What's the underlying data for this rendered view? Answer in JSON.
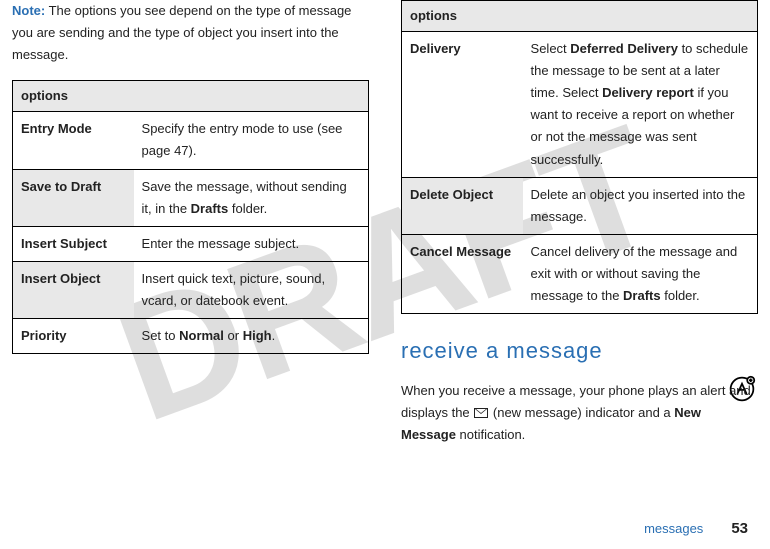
{
  "watermark": "DRAFT",
  "left": {
    "note_label": "Note:",
    "note_text": " The options you see depend on the type of message you are sending and the type of object you insert into the message.",
    "table_header": "options",
    "rows": [
      {
        "k": "Entry Mode",
        "v": "Specify the entry mode to use (see page 47)."
      },
      {
        "k": "Save to Draft",
        "v_pre": "Save the message, without sending it, in the ",
        "v_cond": "Drafts",
        "v_post": " folder."
      },
      {
        "k": "Insert Subject",
        "v": "Enter the message subject."
      },
      {
        "k": "Insert Object",
        "v": "Insert quick text, picture, sound, vcard, or datebook event."
      },
      {
        "k": "Priority",
        "v_pre": "Set to ",
        "v_cond": "Normal",
        "v_mid": " or ",
        "v_cond2": "High",
        "v_post": "."
      }
    ]
  },
  "right": {
    "table_header": "options",
    "rows": [
      {
        "k": "Delivery",
        "v_pre": "Select ",
        "v_cond": "Deferred Delivery",
        "v_mid": " to schedule the message to be sent at a later time. Select ",
        "v_cond2": "Delivery report",
        "v_post": " if you want to receive a report on whether or not the message was sent successfully."
      },
      {
        "k": "Delete Object",
        "v": "Delete an object you inserted into the message."
      },
      {
        "k": "Cancel Message",
        "v_pre": "Cancel delivery of the message and exit with or without saving the message to the ",
        "v_cond": "Drafts",
        "v_post": " folder."
      }
    ],
    "section_title": "receive a message",
    "body_pre": "When you receive a message, your phone plays an alert and displays the ",
    "body_env_label": "(new message)",
    "body_mid": " indicator and a ",
    "body_cond": "New Message",
    "body_post": " notification."
  },
  "footer": {
    "section": "messages",
    "page": "53"
  }
}
